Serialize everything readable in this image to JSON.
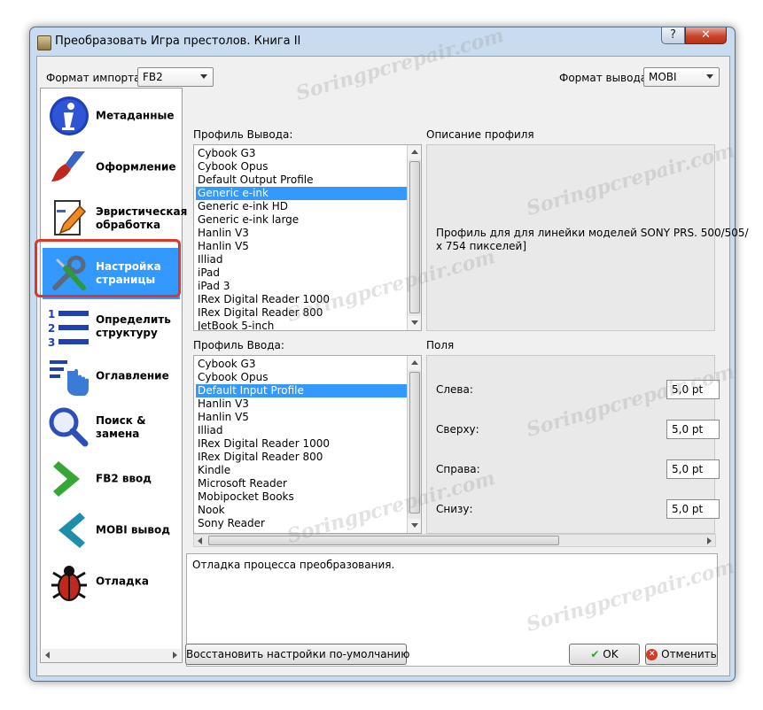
{
  "window": {
    "title": "Преобразовать Игра престолов. Книга II",
    "help_label": "?",
    "close_label": "✕"
  },
  "import_format": {
    "label": "Формат импорта:",
    "value": "FB2"
  },
  "output_format": {
    "label": "Формат вывода:",
    "value": "MOBI"
  },
  "sidebar": {
    "items": [
      {
        "label": "Метаданные",
        "icon": "info-icon"
      },
      {
        "label": "Оформление",
        "icon": "paintbrush-icon"
      },
      {
        "label": "Эвристическая обработка",
        "icon": "document-pencil-icon"
      },
      {
        "label": "Настройка страницы",
        "icon": "wrench-screwdriver-icon",
        "selected": true
      },
      {
        "label": "Определить структуру",
        "icon": "numbered-list-icon"
      },
      {
        "label": "Оглавление",
        "icon": "toc-hand-icon"
      },
      {
        "label": "Поиск & замена",
        "icon": "magnifier-icon"
      },
      {
        "label": "FB2 ввод",
        "icon": "green-arrow-icon"
      },
      {
        "label": "MOBI вывод",
        "icon": "blue-arrow-icon"
      },
      {
        "label": "Отладка",
        "icon": "bug-icon"
      }
    ]
  },
  "output_profile": {
    "label": "Профиль Вывода:",
    "items": [
      "Cybook G3",
      "Cybook Opus",
      "Default Output Profile",
      "Generic e-ink",
      "Generic e-ink HD",
      "Generic e-ink large",
      "Hanlin V3",
      "Hanlin V5",
      "Illiad",
      "iPad",
      "iPad 3",
      "IRex Digital Reader 1000",
      "IRex Digital Reader 800",
      "JetBook 5-inch"
    ],
    "selected": "Generic e-ink"
  },
  "profile_description": {
    "label": "Описание профиля",
    "line1": "Профиль для для линейки моделей SONY PRS. 500/505/",
    "line2": "x 754 пикселей]"
  },
  "input_profile": {
    "label": "Профиль Ввода:",
    "items": [
      "Cybook G3",
      "Cybook Opus",
      "Default Input Profile",
      "Hanlin V3",
      "Hanlin V5",
      "Illiad",
      "IRex Digital Reader 1000",
      "IRex Digital Reader 800",
      "Kindle",
      "Microsoft Reader",
      "Mobipocket Books",
      "Nook",
      "Sony Reader"
    ],
    "selected": "Default Input Profile"
  },
  "margins": {
    "label": "Поля",
    "left": {
      "label": "Слева:",
      "value": "5,0 pt"
    },
    "top": {
      "label": "Сверху:",
      "value": "5,0 pt"
    },
    "right": {
      "label": "Справа:",
      "value": "5,0 pt"
    },
    "bottom": {
      "label": "Снизу:",
      "value": "5,0 pt"
    }
  },
  "debug_text": "Отладка процесса преобразования.",
  "buttons": {
    "restore": "Восстановить настройки по-умолчанию",
    "ok": "OK",
    "cancel": "Отменить"
  },
  "watermark": "Soringpcrepair.com",
  "colors": {
    "selection": "#3399ff",
    "highlight_ring": "#e0352a",
    "ok_check": "#2fa52f",
    "cancel_x": "#d23a2a"
  }
}
